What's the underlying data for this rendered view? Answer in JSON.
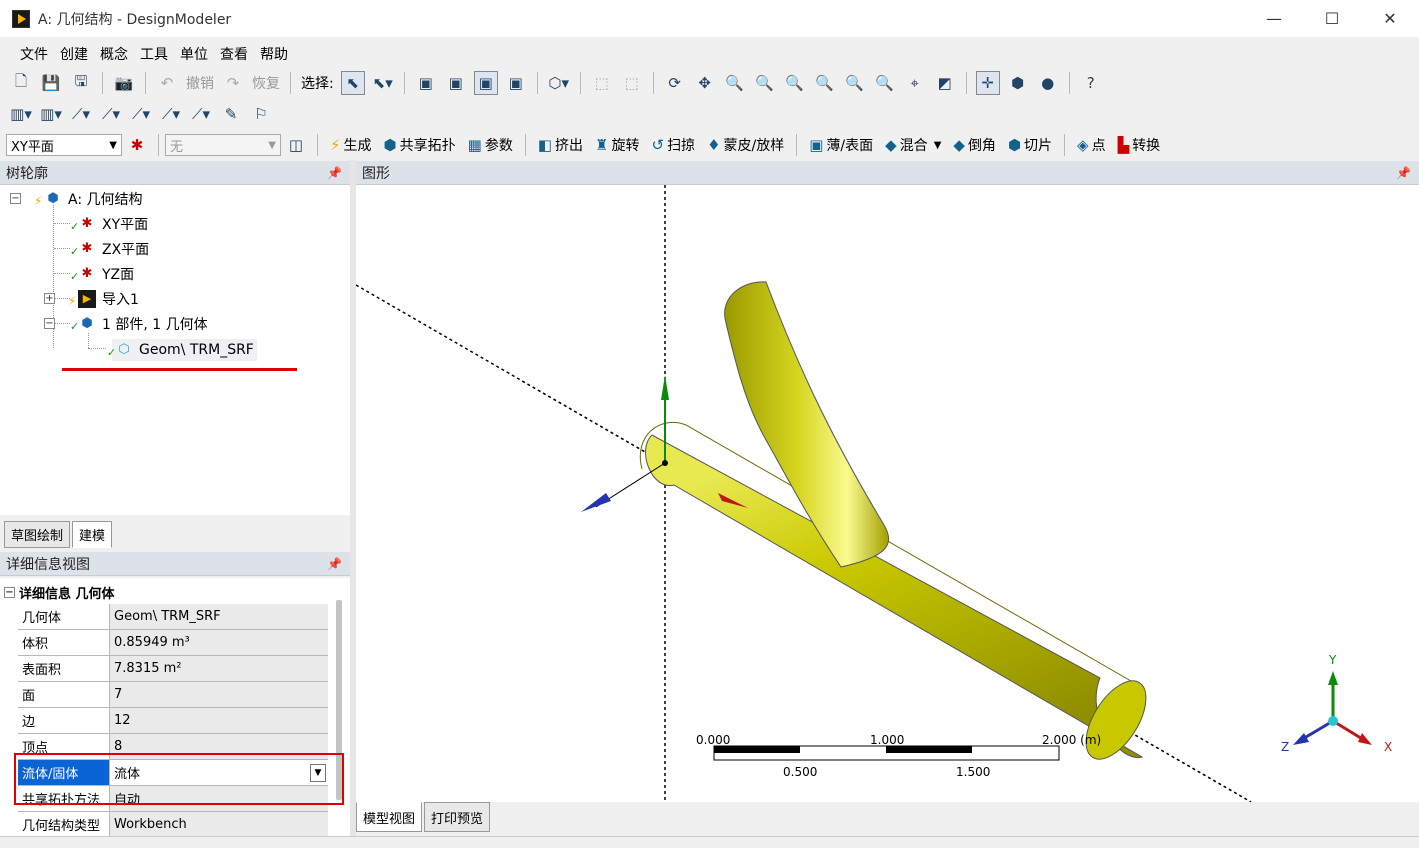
{
  "window": {
    "title": "A: 几何结构 - DesignModeler",
    "minimize": "—",
    "maximize": "☐",
    "close": "✕"
  },
  "menu": [
    "文件",
    "创建",
    "概念",
    "工具",
    "单位",
    "查看",
    "帮助"
  ],
  "toolbar1": {
    "undo": "撤销",
    "redo": "恢复",
    "select_label": "选择:"
  },
  "toolbar3": {
    "plane_combo": "XY平面",
    "sketch_combo": "无",
    "generate": "生成",
    "share_topology": "共享拓扑",
    "parameters": "参数",
    "extrude": "挤出",
    "revolve": "旋转",
    "sweep": "扫掠",
    "skin_loft": "蒙皮/放样",
    "thin_surface": "薄/表面",
    "blend": "混合",
    "chamfer": "倒角",
    "slice": "切片",
    "point": "点",
    "conversion": "转换"
  },
  "tree": {
    "header": "树轮廓",
    "root": "A: 几何结构",
    "items": [
      "XY平面",
      "ZX平面",
      "YZ面",
      "导入1",
      "1 部件, 1 几何体",
      "Geom\\ TRM_SRF"
    ]
  },
  "tabs": {
    "sketching": "草图绘制",
    "modeling": "建模"
  },
  "details": {
    "header": "详细信息视图",
    "title": "详细信息 几何体",
    "rows": [
      {
        "key": "几何体",
        "value": "Geom\\ TRM_SRF"
      },
      {
        "key": "体积",
        "value": "0.85949 m³"
      },
      {
        "key": "表面积",
        "value": "7.8315 m²"
      },
      {
        "key": "面",
        "value": "7"
      },
      {
        "key": "边",
        "value": "12"
      },
      {
        "key": "顶点",
        "value": "8"
      },
      {
        "key": "流体/固体",
        "value": "流体"
      },
      {
        "key": "共享拓扑方法",
        "value": "自动"
      },
      {
        "key": "几何结构类型",
        "value": "Workbench"
      }
    ]
  },
  "graphics": {
    "header": "图形",
    "scale": {
      "t0": "0.000",
      "t1": "1.000",
      "t2": "2.000 (m)",
      "b1": "0.500",
      "b2": "1.500"
    },
    "axes": {
      "y": "Y",
      "z": "Z",
      "x": "X"
    }
  },
  "graphics_tabs": {
    "model_view": "模型视图",
    "print_preview": "打印预览"
  },
  "colors": {
    "body": "#c9c900",
    "highlight_blue": "#0a64d6",
    "annotation_red": "#e00000"
  }
}
